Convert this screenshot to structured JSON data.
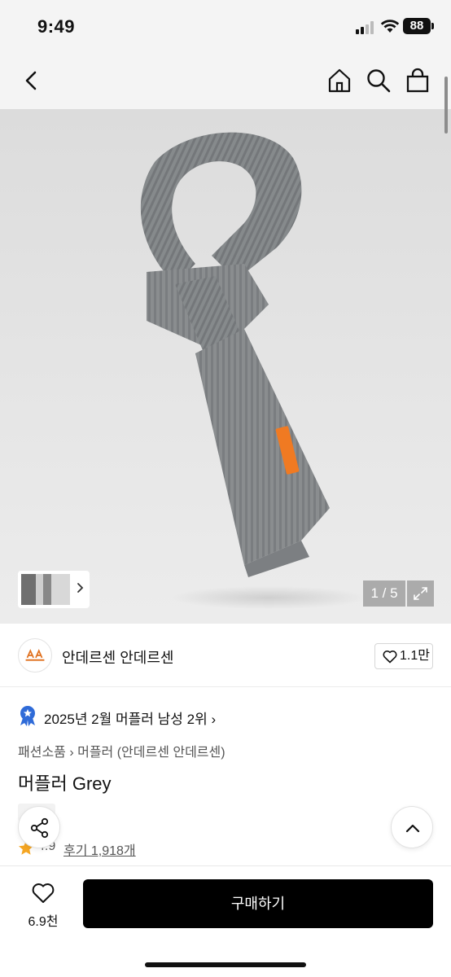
{
  "status": {
    "time": "9:49",
    "battery": "88"
  },
  "gallery": {
    "counter": "1 / 5"
  },
  "brand": {
    "name": "안데르센 안데르센",
    "likes": "1.1만"
  },
  "ranking": {
    "text": "2025년 2월 머플러 남성 2위",
    "chevron": "›"
  },
  "breadcrumb": "패션소품 › 머플러 (안데르센 안데르센)",
  "product": {
    "title": "머플러 Grey"
  },
  "rating": {
    "value": "4.9",
    "reviews": "후기 1,918개"
  },
  "bottom": {
    "wish_count": "6.9천",
    "buy_label": "구매하기"
  },
  "icons": {
    "back": "chevron-left-icon",
    "home": "home-icon",
    "search": "search-icon",
    "bag": "shopping-bag-icon",
    "share": "share-icon",
    "top": "chevron-up-icon",
    "heart": "heart-icon",
    "star": "star-icon",
    "expand": "expand-icon",
    "rank": "rank-badge-icon"
  },
  "colors": {
    "accent": "#000000",
    "star": "#f5a623",
    "rank_badge": "#2f6bd8",
    "label": "#f07a22"
  }
}
